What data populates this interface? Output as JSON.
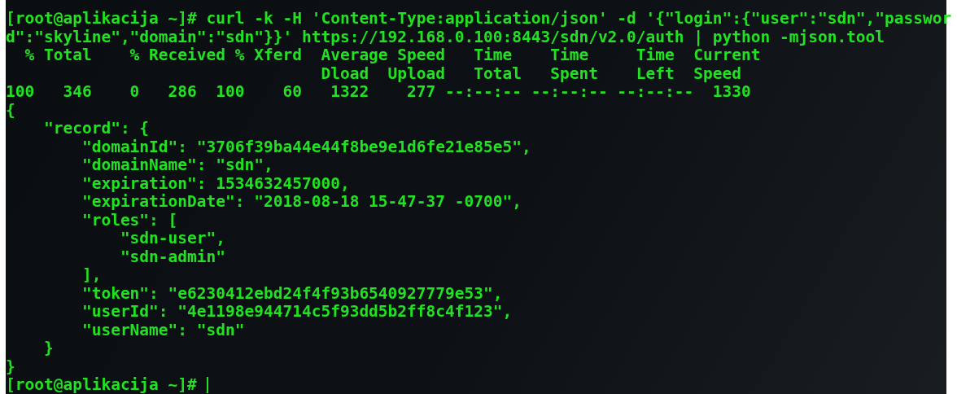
{
  "terminal": {
    "lines": [
      "[root@aplikacija ~]# curl -k -H 'Content-Type:application/json' -d '{\"login\":{\"user\":\"sdn\",\"passwor",
      "d\":\"skyline\",\"domain\":\"sdn\"}}' https://192.168.0.100:8443/sdn/v2.0/auth | python -mjson.tool",
      "  % Total    % Received % Xferd  Average Speed   Time    Time     Time  Current",
      "                                 Dload  Upload   Total   Spent    Left  Speed",
      "100   346    0   286  100    60   1322    277 --:--:-- --:--:-- --:--:--  1330",
      "{",
      "    \"record\": {",
      "        \"domainId\": \"3706f39ba44e44f8be9e1d6fe21e85e5\",",
      "        \"domainName\": \"sdn\",",
      "        \"expiration\": 1534632457000,",
      "        \"expirationDate\": \"2018-08-18 15-47-37 -0700\",",
      "        \"roles\": [",
      "            \"sdn-user\",",
      "            \"sdn-admin\"",
      "        ],",
      "        \"token\": \"e6230412ebd24f4f93b6540927779e53\",",
      "        \"userId\": \"4e1198e944714c5f93dd5b2ff8c4f123\",",
      "        \"userName\": \"sdn\"",
      "    }",
      "}"
    ],
    "prompt": "[root@aplikacija ~]#"
  }
}
